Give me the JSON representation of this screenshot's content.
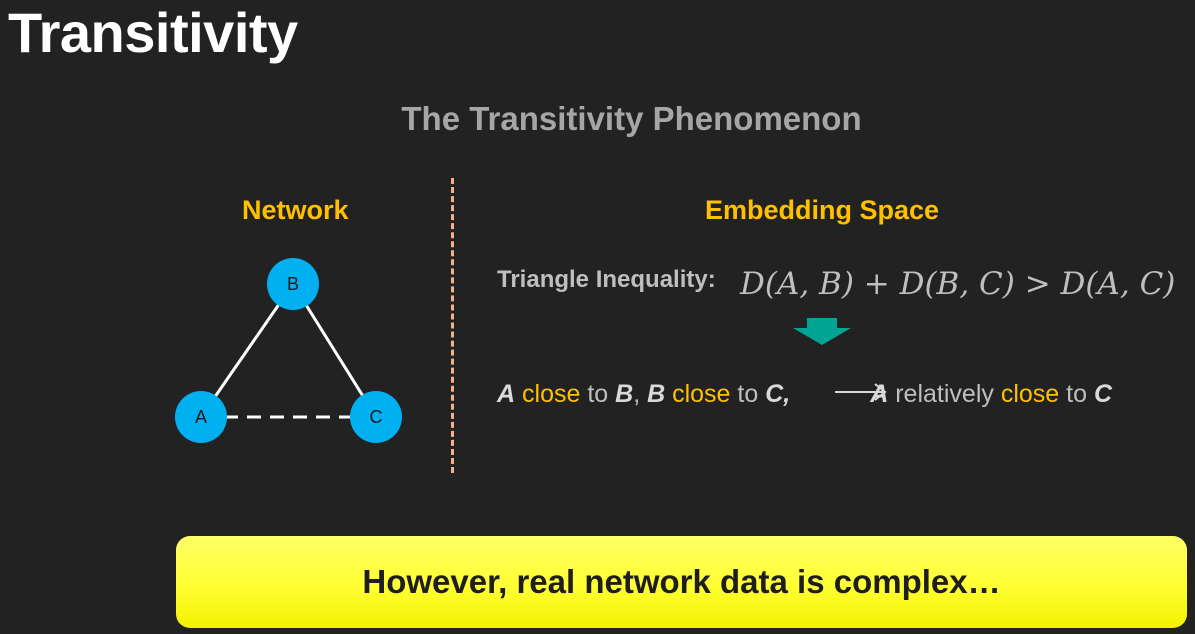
{
  "slide": {
    "title": "Transitivity",
    "subtitle": "The Transitivity Phenomenon"
  },
  "network": {
    "label": "Network",
    "nodes": [
      "A",
      "B",
      "C"
    ],
    "edges": [
      {
        "from": "A",
        "to": "B",
        "style": "solid"
      },
      {
        "from": "B",
        "to": "C",
        "style": "solid"
      },
      {
        "from": "A",
        "to": "C",
        "style": "dashed"
      }
    ],
    "node_color": "#00b0f0"
  },
  "embedding": {
    "label": "Embedding Space",
    "inequality_label": "Triangle Inequality:",
    "formula": "D(A, B) + D(B, C) > D(A, C)",
    "statement": {
      "p1": "A",
      "p2": " close",
      "p3": " to ",
      "p4": "B",
      "p5": ", ",
      "p6": "B",
      "p7": " close",
      "p8": " to ",
      "p9": "C,",
      "p10": "A",
      "p11": " relatively ",
      "p12": "close",
      "p13": " to ",
      "p14": "C"
    }
  },
  "banner": {
    "text": "However, real network data is complex…"
  },
  "colors": {
    "background": "#222222",
    "accent": "#ffc000",
    "arrow": "#00a693",
    "banner": "#ffff33"
  }
}
